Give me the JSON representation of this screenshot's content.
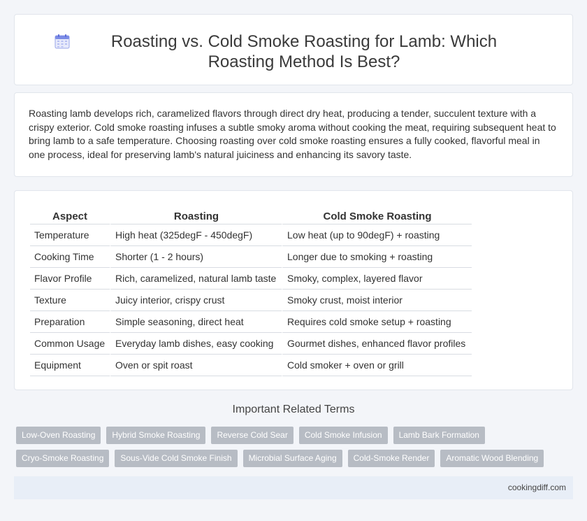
{
  "header": {
    "title": "Roasting vs. Cold Smoke Roasting for Lamb: Which Roasting Method Is Best?",
    "icon": "calendar-icon"
  },
  "intro": {
    "text": "Roasting lamb develops rich, caramelized flavors through direct dry heat, producing a tender, succulent texture with a crispy exterior. Cold smoke roasting infuses a subtle smoky aroma without cooking the meat, requiring subsequent heat to bring lamb to a safe temperature. Choosing roasting over cold smoke roasting ensures a fully cooked, flavorful meal in one process, ideal for preserving lamb's natural juiciness and enhancing its savory taste."
  },
  "table": {
    "headers": [
      "Aspect",
      "Roasting",
      "Cold Smoke Roasting"
    ],
    "rows": [
      [
        "Temperature",
        "High heat (325degF - 450degF)",
        "Low heat (up to 90degF) + roasting"
      ],
      [
        "Cooking Time",
        "Shorter (1 - 2 hours)",
        "Longer due to smoking + roasting"
      ],
      [
        "Flavor Profile",
        "Rich, caramelized, natural lamb taste",
        "Smoky, complex, layered flavor"
      ],
      [
        "Texture",
        "Juicy interior, crispy crust",
        "Smoky crust, moist interior"
      ],
      [
        "Preparation",
        "Simple seasoning, direct heat",
        "Requires cold smoke setup + roasting"
      ],
      [
        "Common Usage",
        "Everyday lamb dishes, easy cooking",
        "Gourmet dishes, enhanced flavor profiles"
      ],
      [
        "Equipment",
        "Oven or spit roast",
        "Cold smoker + oven or grill"
      ]
    ]
  },
  "related": {
    "title": "Important Related Terms",
    "tags": [
      "Low-Oven Roasting",
      "Hybrid Smoke Roasting",
      "Reverse Cold Sear",
      "Cold Smoke Infusion",
      "Lamb Bark Formation",
      "Cryo-Smoke Roasting",
      "Sous-Vide Cold Smoke Finish",
      "Microbial Surface Aging",
      "Cold-Smoke Render",
      "Aromatic Wood Blending"
    ]
  },
  "footer": {
    "site": "cookingdiff.com"
  }
}
